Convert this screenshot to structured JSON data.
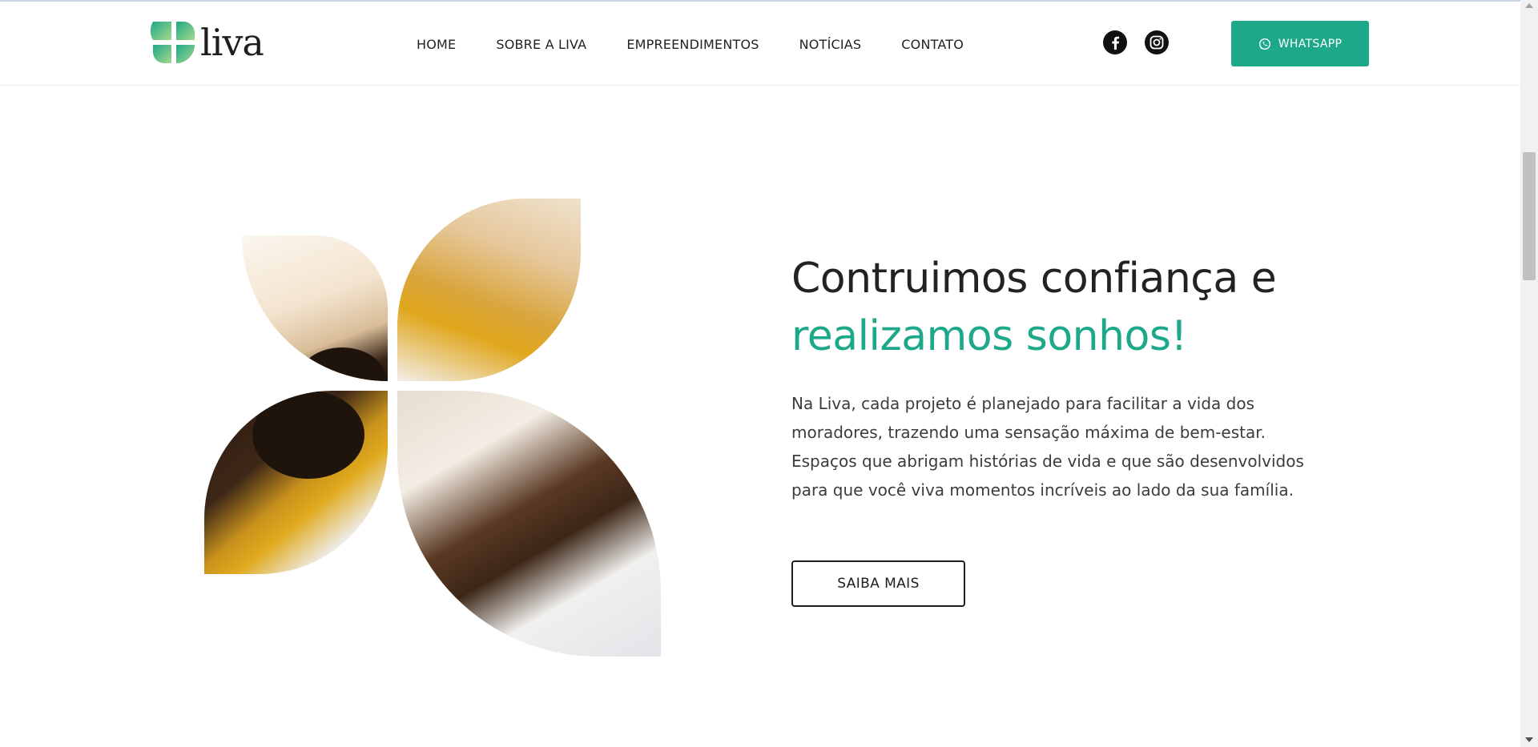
{
  "brand": {
    "name": "liva",
    "accent": "#1ea88a",
    "logo_colors": [
      "#1ea88a",
      "#8fd08a"
    ]
  },
  "nav": {
    "items": [
      {
        "label": "HOME"
      },
      {
        "label": "SOBRE A LIVA"
      },
      {
        "label": "EMPREENDIMENTOS"
      },
      {
        "label": "NOTÍCIAS"
      },
      {
        "label": "CONTATO"
      }
    ]
  },
  "social": {
    "facebook_icon": "facebook-icon",
    "instagram_icon": "instagram-icon"
  },
  "whatsapp": {
    "label": "WHATSAPP",
    "icon": "whatsapp-icon"
  },
  "hero": {
    "headline_line1": "Contruimos confiança e",
    "headline_line2": "realizamos sonhos!",
    "paragraph_lines": [
      "Na Liva, cada projeto é planejado para facilitar a vida dos",
      "moradores, trazendo uma sensação máxima de bem-estar.",
      "Espaços que abrigam histórias de vida e que são desenvolvidos",
      "para que você viva momentos incríveis ao lado da sua família."
    ],
    "cta_label": "SAIBA MAIS"
  }
}
